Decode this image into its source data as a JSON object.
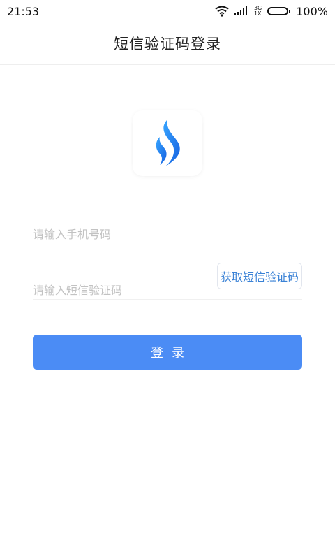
{
  "status_bar": {
    "time": "21:53",
    "network_top": "3G",
    "network_bottom": "1X",
    "battery": "100%",
    "battery_level": 1.0
  },
  "header": {
    "title": "短信验证码登录"
  },
  "logo": {
    "icon": "flame-logo-icon",
    "colors": [
      "#1a73e8",
      "#37a5ff"
    ]
  },
  "form": {
    "phone_placeholder": "请输入手机号码",
    "phone_value": "",
    "code_placeholder": "请输入短信验证码",
    "code_value": "",
    "get_code_label": "获取短信验证码",
    "login_label": "登录"
  },
  "colors": {
    "accent": "#4b8cf5",
    "link": "#3a82d6",
    "placeholder": "#c2c2c2"
  }
}
